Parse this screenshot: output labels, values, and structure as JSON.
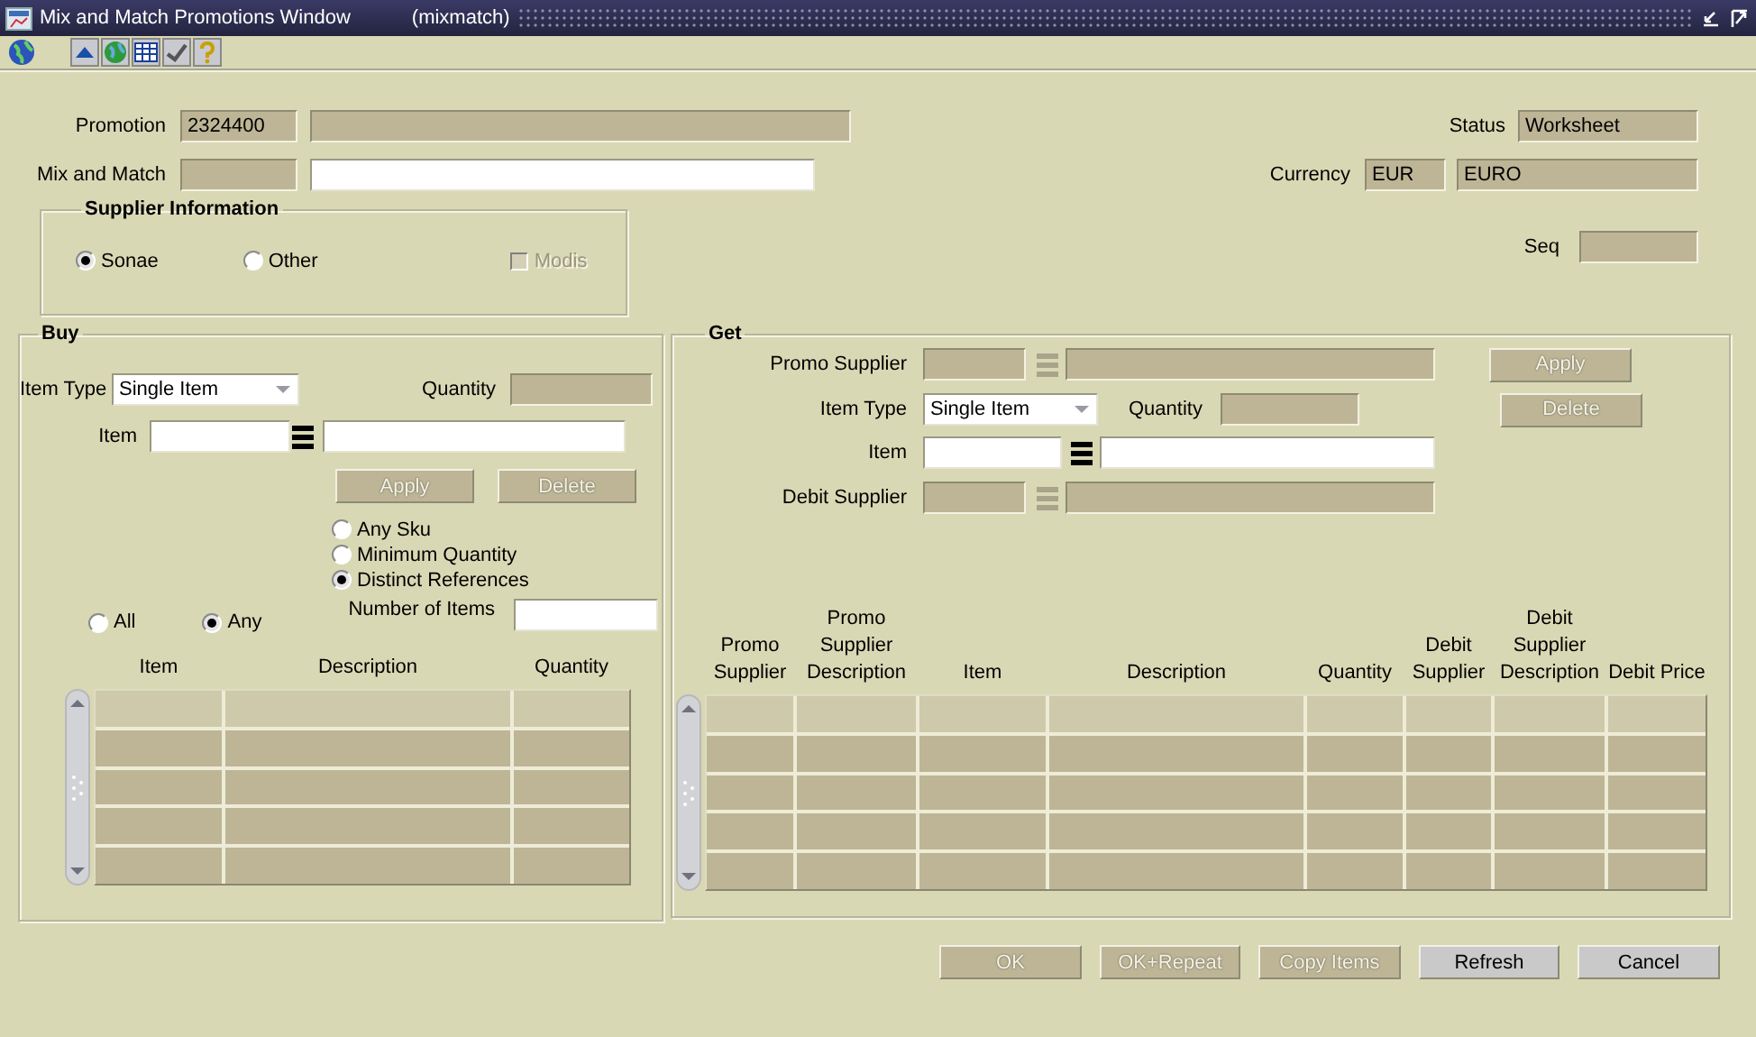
{
  "window": {
    "title": "Mix and Match Promotions Window",
    "module": "(mixmatch)"
  },
  "header": {
    "promotion": {
      "label": "Promotion",
      "code": {
        "value": "2324400",
        "editable": false
      },
      "description": {
        "editable": false
      }
    },
    "mix_and_match": {
      "label": "Mix and Match",
      "code": {
        "editable": false
      },
      "description": {
        "editable": true
      }
    },
    "status": {
      "label": "Status",
      "field": {
        "value": "Worksheet",
        "editable": false
      }
    },
    "currency": {
      "label": "Currency",
      "code": {
        "value": "EUR",
        "editable": false
      },
      "name": {
        "value": "EURO",
        "editable": false
      }
    },
    "seq": {
      "label": "Seq",
      "field": {
        "editable": false
      }
    }
  },
  "supplier_information": {
    "title": "Supplier Information",
    "options": [
      {
        "label": "Sonae",
        "selected": true
      },
      {
        "label": "Other",
        "selected": false
      }
    ],
    "modis": {
      "label": "Modis",
      "checked": false,
      "disabled": true
    }
  },
  "buy": {
    "title": "Buy",
    "item_type": {
      "label": "Item Type",
      "value": "Single Item"
    },
    "quantity": {
      "label": "Quantity",
      "field": {
        "editable": false
      }
    },
    "item": {
      "label": "Item",
      "code": {
        "editable": true
      },
      "lookup": {
        "disabled": false
      },
      "description": {
        "editable": true
      }
    },
    "buttons": [
      {
        "label": "Apply",
        "disabled": true
      },
      {
        "label": "Delete",
        "disabled": true
      }
    ],
    "rule_options": [
      {
        "label": "Any Sku",
        "selected": false
      },
      {
        "label": "Minimum Quantity",
        "selected": false
      },
      {
        "label": "Distinct References",
        "selected": true
      }
    ],
    "match_options": [
      {
        "label": "All",
        "selected": false
      },
      {
        "label": "Any",
        "selected": true
      }
    ],
    "number_of_items": {
      "label": "Number of Items",
      "field": {
        "editable": true
      }
    },
    "table": {
      "columns": [
        "Item",
        "Description",
        "Quantity"
      ]
    }
  },
  "get": {
    "title": "Get",
    "promo_supplier": {
      "label": "Promo Supplier",
      "code": {
        "editable": false
      },
      "lookup": {
        "disabled": true
      },
      "description": {
        "editable": false
      }
    },
    "item_type": {
      "label": "Item Type",
      "value": "Single Item"
    },
    "quantity": {
      "label": "Quantity",
      "field": {
        "editable": false
      }
    },
    "item": {
      "label": "Item",
      "code": {
        "editable": true
      },
      "lookup": {
        "disabled": false
      },
      "description": {
        "editable": true
      }
    },
    "debit_supplier": {
      "label": "Debit Supplier",
      "code": {
        "editable": false
      },
      "lookup": {
        "disabled": true
      },
      "description": {
        "editable": false
      }
    },
    "buttons": [
      {
        "label": "Apply",
        "disabled": true
      },
      {
        "label": "Delete",
        "disabled": true
      }
    ],
    "table": {
      "columns": [
        "Promo Supplier",
        "Promo Supplier Description",
        "Item",
        "Description",
        "Quantity",
        "Debit Supplier",
        "Debit Supplier Description",
        "Debit Price"
      ]
    }
  },
  "footer_buttons": [
    {
      "label": "OK",
      "disabled": true
    },
    {
      "label": "OK+Repeat",
      "disabled": true
    },
    {
      "label": "Copy Items",
      "disabled": true
    },
    {
      "label": "Refresh",
      "disabled": false
    },
    {
      "label": "Cancel",
      "disabled": false
    }
  ]
}
